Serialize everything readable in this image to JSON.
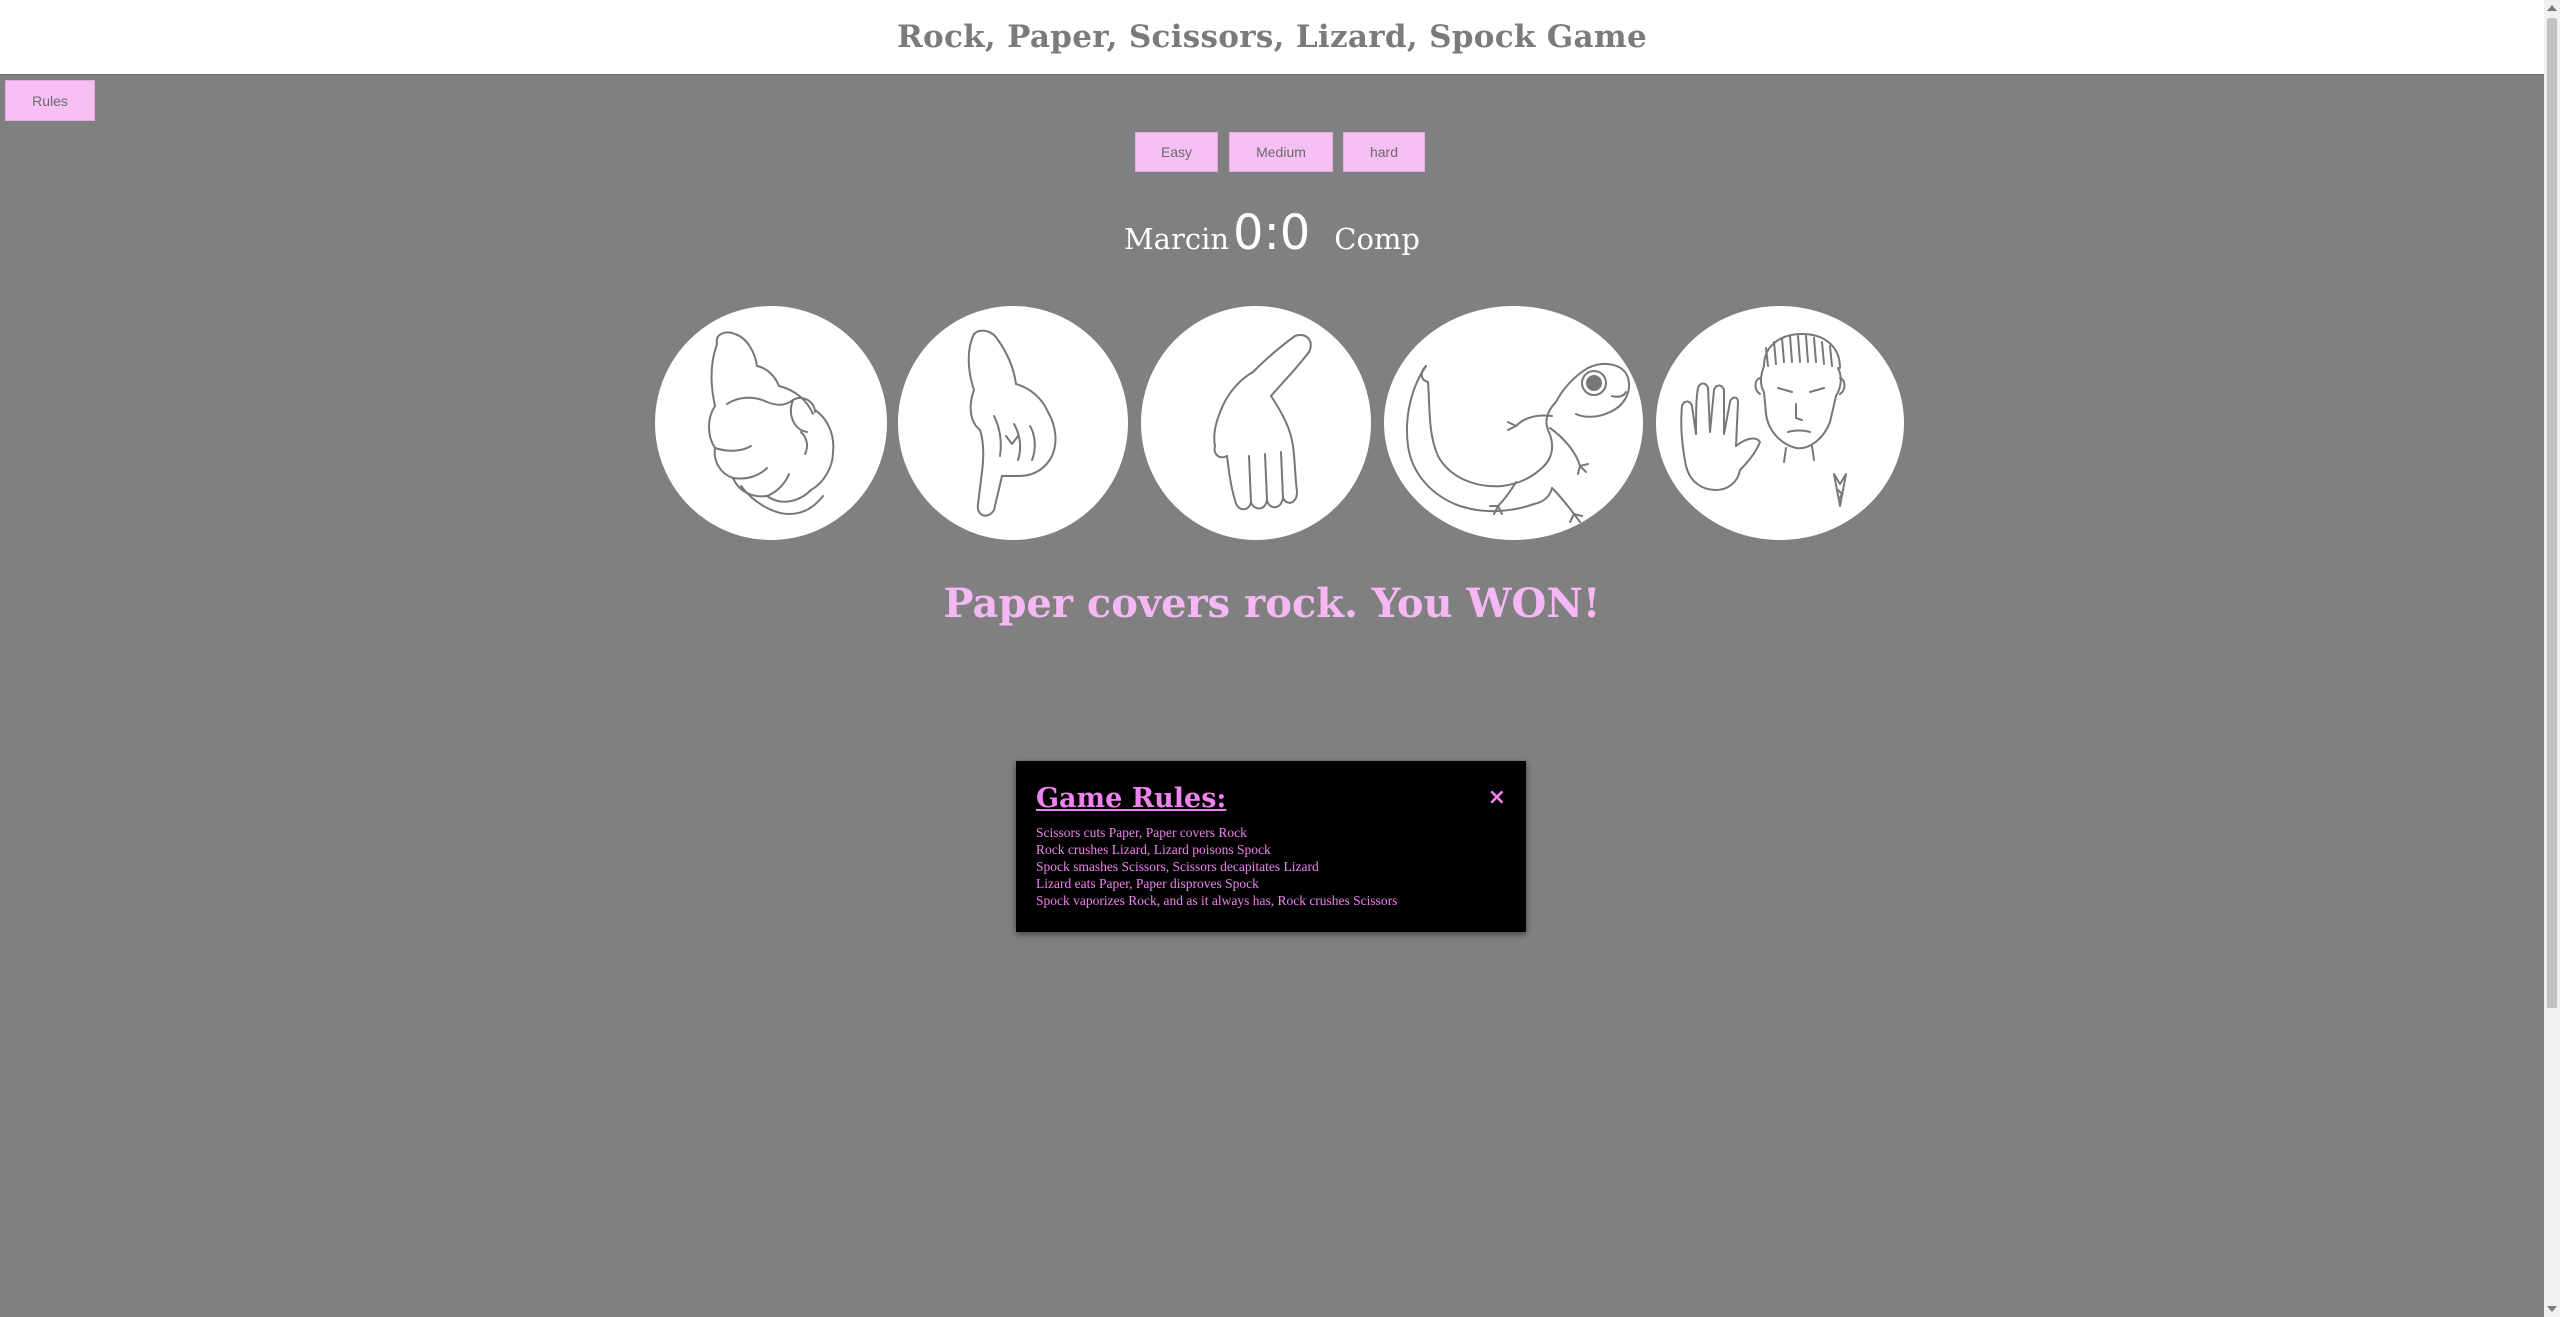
{
  "header": {
    "title": "Rock, Paper, Scissors, Lizard, Spock Game"
  },
  "toolbar": {
    "rules_label": "Rules"
  },
  "difficulty": {
    "easy": "Easy",
    "medium": "Medium",
    "hard": "hard"
  },
  "scoreboard": {
    "player": "Marcin",
    "score": "0:0",
    "computer": "Comp"
  },
  "choices": [
    {
      "id": "rock",
      "icon": "rock-hand-icon"
    },
    {
      "id": "paper",
      "icon": "paper-hand-icon"
    },
    {
      "id": "scissors",
      "icon": "scissors-hand-icon"
    },
    {
      "id": "lizard",
      "icon": "lizard-icon"
    },
    {
      "id": "spock",
      "icon": "spock-icon"
    }
  ],
  "result": {
    "message": "Paper covers rock. You WON!"
  },
  "rules_modal": {
    "title": "Game Rules:",
    "close_symbol": "×",
    "rules": [
      "Scissors cuts Paper, Paper covers Rock",
      "Rock crushes Lizard, Lizard poisons Spock",
      "Spock smashes Scissors, Scissors decapitates Lizard",
      "Lizard eats Paper, Paper disproves Spock",
      "Spock vaporizes Rock, and as it always has, Rock crushes Scissors"
    ]
  },
  "colors": {
    "background": "#808080",
    "accent_pink": "#f6c0f4",
    "result_text": "#f6b8f4",
    "modal_text": "#ee82ee",
    "modal_bg": "#000000"
  }
}
